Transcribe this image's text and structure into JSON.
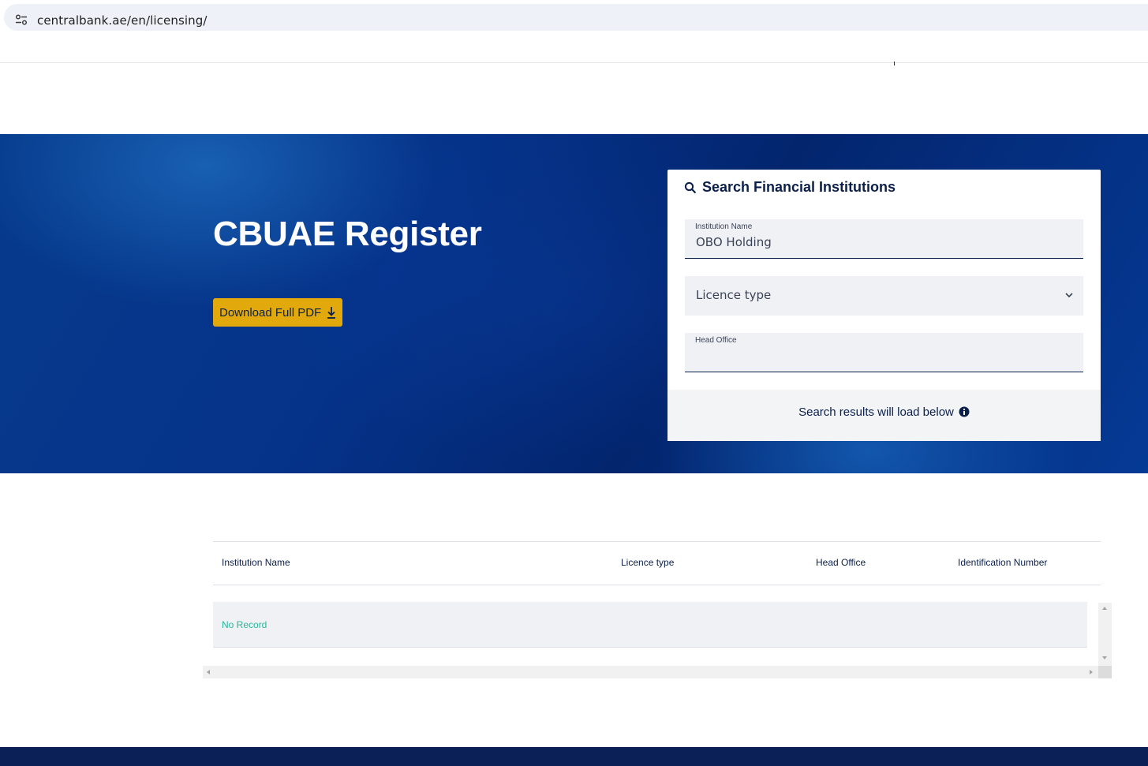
{
  "browser": {
    "url": "centralbank.ae/en/licensing/",
    "site_info_icon": "site-settings-icon"
  },
  "hero": {
    "title": "CBUAE Register",
    "download_button_label": "Download Full PDF",
    "download_icon": "download-icon"
  },
  "search": {
    "title": "Search Financial Institutions",
    "title_icon": "search-icon",
    "institution_name": {
      "label": "Institution Name",
      "value": "OBO Holding"
    },
    "licence_type": {
      "placeholder": "Licence type",
      "icon": "chevron-down-icon"
    },
    "head_office": {
      "label": "Head Office",
      "value": ""
    },
    "footer_note": "Search results will load below",
    "footer_icon": "info-icon"
  },
  "results": {
    "columns": [
      "Institution Name",
      "Licence type",
      "Head Office",
      "Identification Number"
    ],
    "empty_text": "No Record"
  },
  "colors": {
    "navy": "#0b1f4b",
    "hero_blue": "#05338a",
    "accent_gold": "#e2a90c",
    "empty_green": "#2bb59a",
    "field_bg": "#f0f1f5"
  }
}
